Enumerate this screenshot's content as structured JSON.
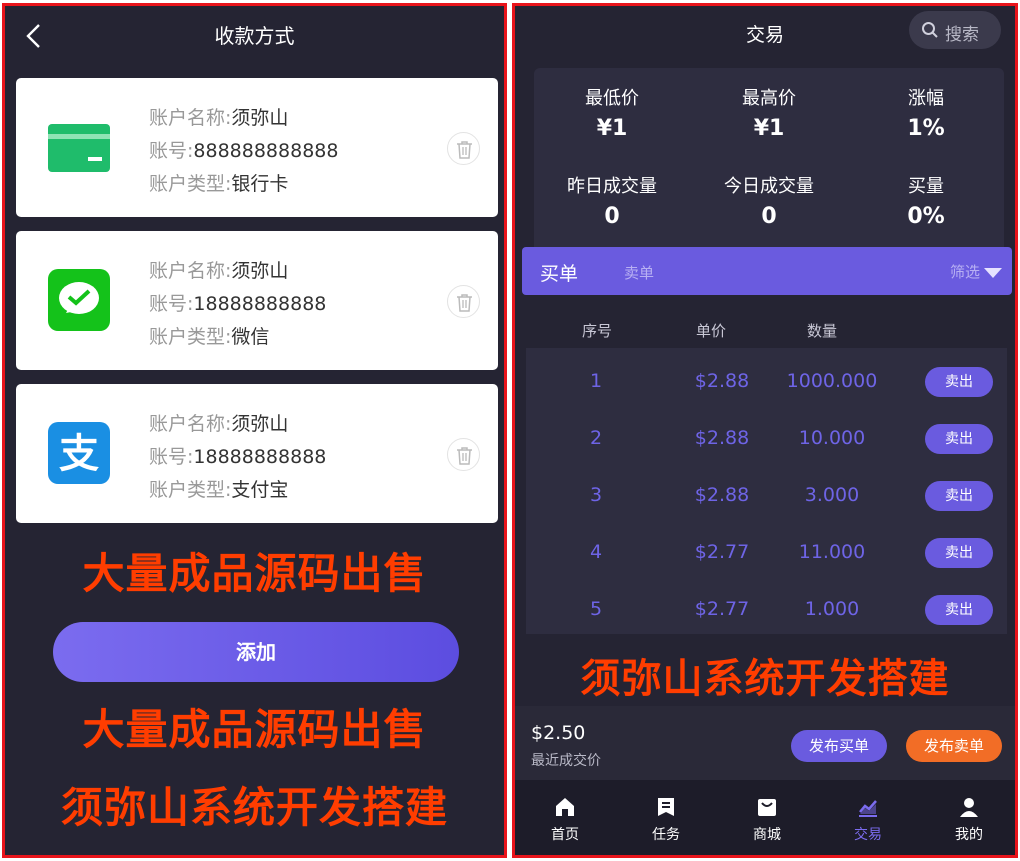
{
  "left": {
    "title": "收款方式",
    "cards": [
      {
        "name_label": "账户名称:",
        "name_value": "须弥山",
        "account_label": "账号:",
        "account_value": "888888888888",
        "type_label": "账户类型:",
        "type_value": "银行卡",
        "icon": "bank-card-icon",
        "color": "#1fbc6b"
      },
      {
        "name_label": "账户名称:",
        "name_value": "须弥山",
        "account_label": "账号:",
        "account_value": "18888888888",
        "type_label": "账户类型:",
        "type_value": "微信",
        "icon": "wechat-icon",
        "color": "#14c21a"
      },
      {
        "name_label": "账户名称:",
        "name_value": "须弥山",
        "account_label": "账号:",
        "account_value": "18888888888",
        "type_label": "账户类型:",
        "type_value": "支付宝",
        "icon": "alipay-icon",
        "color": "#1a8fe3"
      }
    ],
    "promo_1": "大量成品源码出售",
    "add_label": "添加",
    "promo_2": "大量成品源码出售",
    "promo_3": "须弥山系统开发搭建"
  },
  "right": {
    "title": "交易",
    "search_label": "搜索",
    "stats": [
      {
        "label": "最低价",
        "value": "¥1"
      },
      {
        "label": "最高价",
        "value": "¥1"
      },
      {
        "label": "涨幅",
        "value": "1%"
      },
      {
        "label": "昨日成交量",
        "value": "0"
      },
      {
        "label": "今日成交量",
        "value": "0"
      },
      {
        "label": "买量",
        "value": "0%"
      }
    ],
    "tabs": {
      "buy": "买单",
      "sell": "卖单",
      "filter": "筛选"
    },
    "columns": {
      "index": "序号",
      "price": "单价",
      "quantity": "数量"
    },
    "orders": [
      {
        "index": "1",
        "price": "$2.88",
        "quantity": "1000.000",
        "action": "卖出"
      },
      {
        "index": "2",
        "price": "$2.88",
        "quantity": "10.000",
        "action": "卖出"
      },
      {
        "index": "3",
        "price": "$2.88",
        "quantity": "3.000",
        "action": "卖出"
      },
      {
        "index": "4",
        "price": "$2.77",
        "quantity": "11.000",
        "action": "卖出"
      },
      {
        "index": "5",
        "price": "$2.77",
        "quantity": "1.000",
        "action": "卖出"
      }
    ],
    "promo": "须弥山系统开发搭建",
    "last_price": "$2.50",
    "last_price_label": "最近成交价",
    "publish_buy": "发布买单",
    "publish_sell": "发布卖单",
    "nav": [
      {
        "label": "首页",
        "icon": "home-icon",
        "active": false
      },
      {
        "label": "任务",
        "icon": "task-icon",
        "active": false
      },
      {
        "label": "商城",
        "icon": "mall-icon",
        "active": false
      },
      {
        "label": "交易",
        "icon": "trade-icon",
        "active": true
      },
      {
        "label": "我的",
        "icon": "user-icon",
        "active": false
      }
    ]
  },
  "colors": {
    "accent": "#6a5bdf",
    "promo": "#ff3d00",
    "sell": "#f26d26",
    "frame": "#e8141b",
    "background": "#252433"
  }
}
